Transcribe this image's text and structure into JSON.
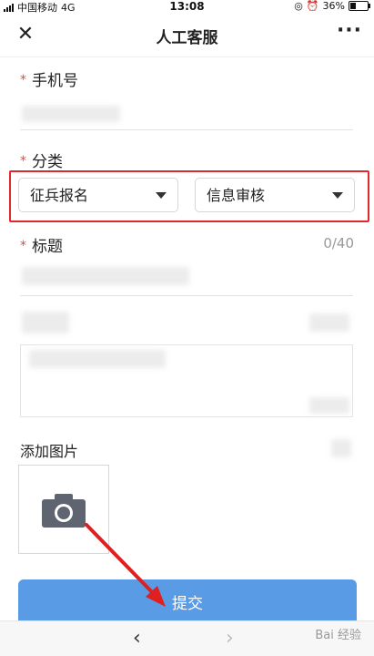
{
  "status_bar": {
    "carrier": "中国移动",
    "network": "4G",
    "time": "13:08",
    "battery_pct": "36%",
    "battery_level": 0.36
  },
  "nav": {
    "close_icon": "close-icon",
    "title": "人工客服",
    "more_icon": "more-dots-icon"
  },
  "form": {
    "phone_label": "手机号",
    "category_label": "分类",
    "category_primary": "征兵报名",
    "category_secondary": "信息审核",
    "title_label": "标题",
    "title_counter": "0/40",
    "add_image_label": "添加图片",
    "submit_label": "提交"
  },
  "toolbar": {
    "back": "‹",
    "forward": "›",
    "watermark": "Bai 经验"
  },
  "colors": {
    "primary_button": "#5a9be6",
    "required_star": "#e24c3f",
    "highlight_border": "#e02828"
  }
}
